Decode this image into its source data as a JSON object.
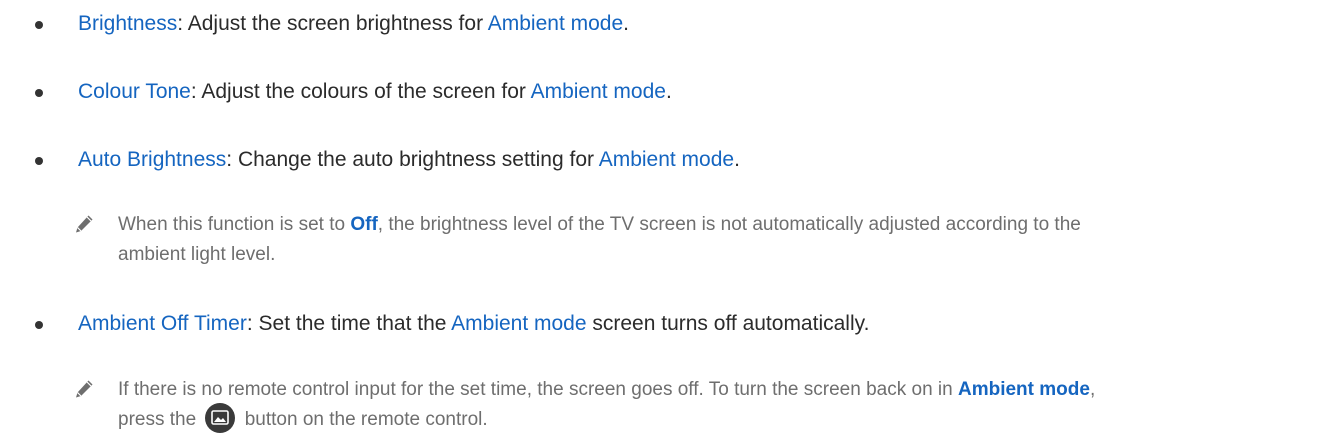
{
  "items": [
    {
      "term": "Brightness",
      "sep": ": ",
      "desc": "Adjust the screen brightness for ",
      "ref": "Ambient mode",
      "end": "."
    },
    {
      "term": "Colour Tone",
      "sep": ": ",
      "desc": "Adjust the colours of the screen for ",
      "ref": "Ambient mode",
      "end": "."
    },
    {
      "term": "Auto Brightness",
      "sep": ": ",
      "desc": "Change the auto brightness setting for ",
      "ref": "Ambient mode",
      "end": "."
    },
    {
      "term": "Ambient Off Timer",
      "sep": ": ",
      "desc": "Set the time that the ",
      "ref": "Ambient mode",
      "desc2": " screen turns off automatically."
    }
  ],
  "notes": [
    {
      "icon": "pencil-icon",
      "pre": "When this function is set to ",
      "ref": "Off",
      "post": ", the brightness level of the TV screen is not automatically adjusted according to the",
      "line2": "ambient light level."
    },
    {
      "icon": "pencil-icon",
      "pre": "If there is no remote control input for the set time, the screen goes off. To turn the screen back on in ",
      "ref": "Ambient mode",
      "end": ",",
      "line2_pre": "press the ",
      "button_icon": "ambient-mode-button-icon",
      "line2_post": " button on the remote control."
    }
  ],
  "colors": {
    "accent": "#1565c0",
    "body_text": "#2b2b2b",
    "note_text": "#6e6e6e"
  }
}
